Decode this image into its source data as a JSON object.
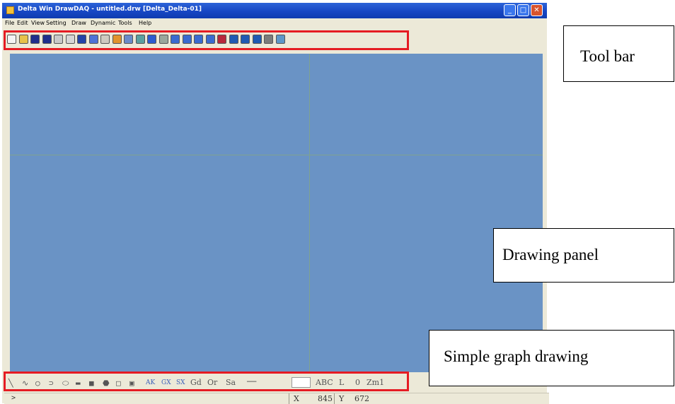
{
  "window": {
    "title": "Delta Win DrawDAQ - untitled.drw [Delta_Delta-01]",
    "controls": {
      "minimize": "_",
      "maximize": "□",
      "close": "✕"
    }
  },
  "menubar": [
    "File",
    "Edit",
    "View",
    "Setting",
    "Draw",
    "Dynamic",
    "Tools",
    "Help"
  ],
  "toolbar": {
    "icons": [
      {
        "name": "new-file-icon",
        "color": "#f4f4f4"
      },
      {
        "name": "open-folder-icon",
        "color": "#e7c24a"
      },
      {
        "name": "save-icon",
        "color": "#1f2f8c"
      },
      {
        "name": "save-as-icon",
        "color": "#1f2f8c"
      },
      {
        "name": "print-icon",
        "color": "#c9c9c9"
      },
      {
        "name": "cut-icon",
        "color": "#d6d6d6"
      },
      {
        "name": "list-icon",
        "color": "#2243a8"
      },
      {
        "name": "color-palette-icon",
        "color": "#4e73d6"
      },
      {
        "name": "disabled-tool-icon",
        "color": "#cfcac0"
      },
      {
        "name": "layer-icon",
        "color": "#e2932d"
      },
      {
        "name": "window-icon",
        "color": "#6a8bc9"
      },
      {
        "name": "grid-icon",
        "color": "#5aa0a0"
      },
      {
        "name": "table-icon",
        "color": "#2c5bd0"
      },
      {
        "name": "chart-icon",
        "color": "#9aa79c"
      },
      {
        "name": "trend-icon",
        "color": "#3a6bd0"
      },
      {
        "name": "trend-alt-icon",
        "color": "#3a6bd0"
      },
      {
        "name": "curve-icon",
        "color": "#3a6bd0"
      },
      {
        "name": "curve-alt-icon",
        "color": "#3a6bd0"
      },
      {
        "name": "bar-chart-icon",
        "color": "#b8283c"
      },
      {
        "name": "meter-icon",
        "color": "#1f5ab3"
      },
      {
        "name": "dial-icon",
        "color": "#1f5ab3"
      },
      {
        "name": "gauge-icon",
        "color": "#1f5ab3"
      },
      {
        "name": "tools-icon",
        "color": "#7b7b7b"
      },
      {
        "name": "wizard-icon",
        "color": "#5d97c9"
      }
    ]
  },
  "drawing_tools": {
    "shapes": [
      {
        "name": "line-tool-icon",
        "glyph": "╲"
      },
      {
        "name": "polyline-tool-icon",
        "glyph": "∿"
      },
      {
        "name": "circle-tool-icon",
        "glyph": "○"
      },
      {
        "name": "arc-tool-icon",
        "glyph": "⊃"
      },
      {
        "name": "ellipse-tool-icon",
        "glyph": "⬭"
      },
      {
        "name": "fill-tool-icon",
        "glyph": "▬"
      },
      {
        "name": "rect-fill-tool-icon",
        "glyph": "■"
      },
      {
        "name": "polygon-tool-icon",
        "glyph": "⬣"
      },
      {
        "name": "rectangle-tool-icon",
        "glyph": "□"
      },
      {
        "name": "bitmap-tool-icon",
        "glyph": "▣"
      }
    ],
    "small_labels": [
      "AK",
      "GX",
      "SX"
    ],
    "text_buttons": [
      "Gd",
      "Or",
      "Sa"
    ],
    "right_buttons": [
      "ABC",
      "L",
      "0",
      "Zm1"
    ]
  },
  "status": {
    "prompt": ">",
    "x_label": "X",
    "x_value": "845",
    "y_label": "Y",
    "y_value": "672"
  },
  "annotations": {
    "toolbar": "Tool bar",
    "drawing_panel": "Drawing panel",
    "simple_graph": "Simple graph drawing"
  },
  "colors": {
    "canvas": "#6a93c5",
    "grid": "#7fa28f",
    "highlight": "#e51c23"
  }
}
